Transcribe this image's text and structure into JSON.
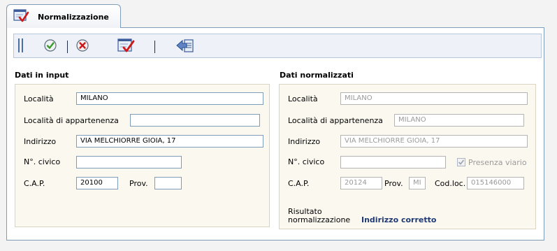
{
  "tab": {
    "title": "Normalizzazione",
    "icon": "form-check-icon"
  },
  "toolbar": {
    "buttons": [
      {
        "name": "confirm-button",
        "icon": "check-circle-icon"
      },
      {
        "name": "cancel-button",
        "icon": "x-circle-icon"
      },
      {
        "name": "normalize-button",
        "icon": "form-check-icon"
      },
      {
        "name": "back-button",
        "icon": "back-arrow-icon"
      }
    ]
  },
  "input": {
    "title": "Dati in input",
    "localita": {
      "label": "Località",
      "value": "MILANO"
    },
    "localita_appartenenza": {
      "label": "Località di appartenenza",
      "value": ""
    },
    "indirizzo": {
      "label": "Indirizzo",
      "value": "VIA MELCHIORRE GIOIA, 17"
    },
    "civico": {
      "label": "N°. civico",
      "value": ""
    },
    "cap": {
      "label": "C.A.P.",
      "value": "20100"
    },
    "prov": {
      "label": "Prov.",
      "value": ""
    }
  },
  "normalized": {
    "title": "Dati normalizzati",
    "localita": {
      "label": "Località",
      "value": "MILANO"
    },
    "localita_appartenenza": {
      "label": "Località di appartenenza",
      "value": "MILANO"
    },
    "indirizzo": {
      "label": "Indirizzo",
      "value": "VIA MELCHIORRE GIOIA, 17"
    },
    "civico": {
      "label": "N°. civico",
      "value": ""
    },
    "presenza_viario": {
      "label": "Presenza viario",
      "checked": true
    },
    "cap": {
      "label": "C.A.P.",
      "value": "20124"
    },
    "prov": {
      "label": "Prov.",
      "value": "MI"
    },
    "codloc": {
      "label": "Cod.loc.",
      "value": "015146000"
    },
    "risultato": {
      "label_line1": "Risultato",
      "label_line2": "normalizzazione",
      "value": "Indirizzo corretto"
    }
  },
  "colors": {
    "accent": "#1f3a73",
    "border": "#7f9db9",
    "section_bg": "#fbf8f0"
  }
}
